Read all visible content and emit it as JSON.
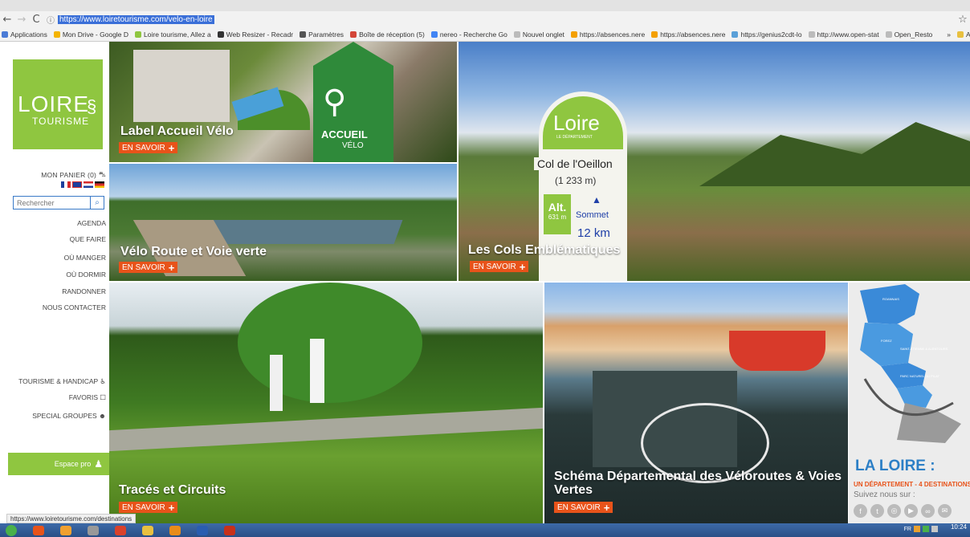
{
  "browser": {
    "url": "https://www.loiretourisme.com/velo-en-loire",
    "info_icon": "info-icon",
    "bookmarks": [
      {
        "label": "Applications",
        "color": "#4a7bd6"
      },
      {
        "label": "Mon Drive - Google D",
        "color": "#f4b400"
      },
      {
        "label": "Loire tourisme, Allez a",
        "color": "#8fc640"
      },
      {
        "label": "Web Resizer - Recadr",
        "color": "#333333"
      },
      {
        "label": "Paramètres",
        "color": "#555555"
      },
      {
        "label": "Boîte de réception (5)",
        "color": "#d44638"
      },
      {
        "label": "nereo - Recherche Go",
        "color": "#4285f4"
      },
      {
        "label": "Nouvel onglet",
        "color": "#bbbbbb"
      },
      {
        "label": "https://absences.nere",
        "color": "#f4a000"
      },
      {
        "label": "https://absences.nere",
        "color": "#f4a000"
      },
      {
        "label": "https://genius2cdt-lo",
        "color": "#5aa0d8"
      },
      {
        "label": "http://www.open-stat",
        "color": "#bbbbbb"
      },
      {
        "label": "Open_Resto",
        "color": "#bbbbbb"
      }
    ],
    "more_label": "»",
    "other_bookmarks": "Autres favori"
  },
  "sidebar": {
    "logo_main": "LOIRE",
    "logo_sub": "TOURISME",
    "cart": "MON PANIER (0)",
    "search_placeholder": "Rechercher",
    "menu": [
      "AGENDA",
      "QUE FAIRE",
      "OÙ MANGER",
      "OÙ DORMIR",
      "RANDONNER",
      "NOUS CONTACTER"
    ],
    "extra": [
      "TOURISME & HANDICAP",
      "FAVORIS",
      "SPECIAL GROUPES"
    ],
    "espace_pro": "Espace pro"
  },
  "tiles": {
    "accueil": {
      "title": "Label Accueil Vélo",
      "badge_top": "ACCUEIL",
      "badge_bottom": "VÉLO"
    },
    "voie": {
      "title": "Vélo Route et Voie verte"
    },
    "cols": {
      "title": "Les Cols Emblématiques",
      "sign_brand": "Loire",
      "sign_sub": "LE DÉPARTEMENT",
      "sign_name": "Col de l'Oeillon",
      "sign_alt": "(1 233 m)",
      "sign_alt_label": "Alt.",
      "sign_alt_value": "631 m",
      "sign_summit": "Sommet",
      "sign_km": "12 km"
    },
    "traces": {
      "title": "Tracés et Circuits"
    },
    "schema": {
      "title": "Schéma Départemental des Véloroutes & Voies Vertes"
    },
    "more_label": "EN SAVOIR"
  },
  "map_labels": [
    "ROANNAIS",
    "FOREZ",
    "SAINT-ETIENNE & ALENTOURS",
    "PARC NATUREL DU PILAT"
  ],
  "right_panel": {
    "title": "LA LOIRE :",
    "subtitle": "UN DÉPARTEMENT - 4 DESTINATIONS",
    "follow": "Suivez nous sur :"
  },
  "status_url": "https://www.loiretourisme.com/destinations",
  "taskbar": {
    "lang": "FR",
    "time": "10:24",
    "apps": [
      "#e8531a",
      "#f0a030",
      "#999999",
      "#d9412c",
      "#e8c040",
      "#e88c1a",
      "#2a5db0",
      "#c8301a"
    ]
  },
  "colors": {
    "green": "#8fc640",
    "orange": "#e8531a",
    "blue": "#2c7fc6"
  }
}
